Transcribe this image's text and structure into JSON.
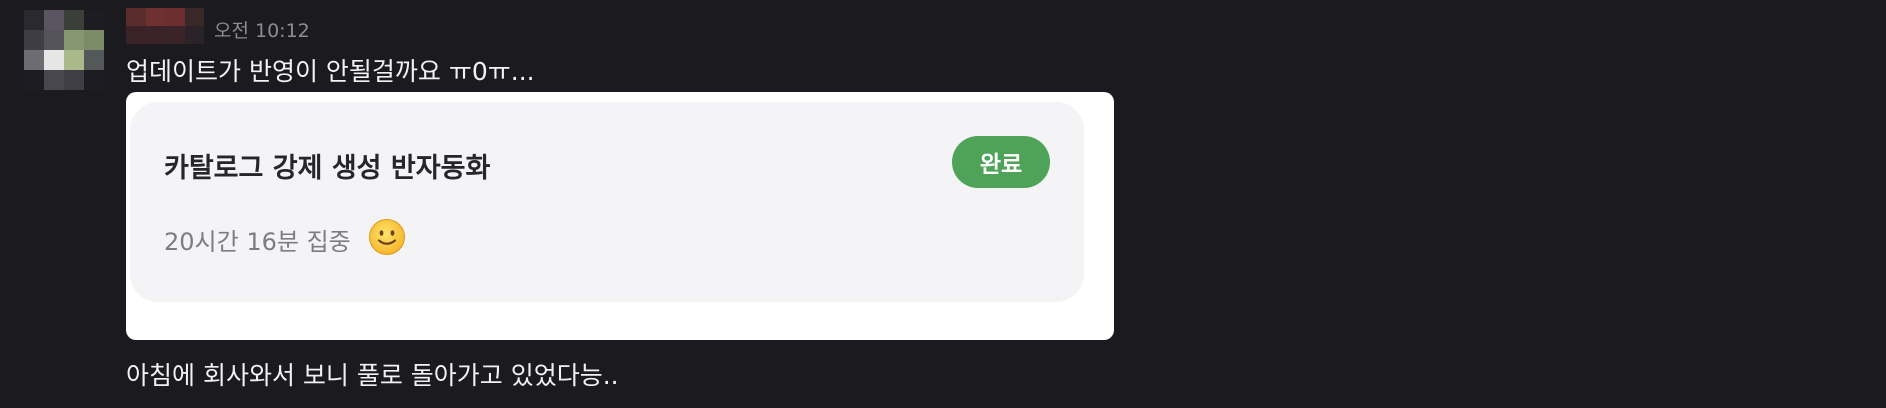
{
  "message": {
    "timestamp": "오전 10:12",
    "text": "업데이트가 반영이 안될걸까요 ㅠ0ㅠ...",
    "followup_text": "아침에 회사와서 보니 풀로 돌아가고 있었다능.."
  },
  "task_card": {
    "title": "카탈로그 강제 생성 반자동화",
    "status_label": "완료",
    "focus_time": "20시간 16분 집중",
    "status_color": "#4ea359",
    "emoji_icon": "slightly-smiling-face-icon"
  },
  "avatar_pixels": [
    "#2a2930",
    "#5a5560",
    "#3a3f3a",
    "#1d1c22",
    "#3e3d44",
    "#55545a",
    "#86966e",
    "#7c8c68",
    "#6d6c72",
    "#e6e6e6",
    "#a9b98a",
    "#545858",
    "#1d1c22",
    "#48474d",
    "#3e3e44",
    "#1d1c22"
  ],
  "author_name_pixels": [
    "#5a2d2d",
    "#6e3030",
    "#6b2f2f",
    "#3a2828",
    "#3a2226",
    "#3a2227",
    "#3b2427",
    "#2a2328"
  ]
}
